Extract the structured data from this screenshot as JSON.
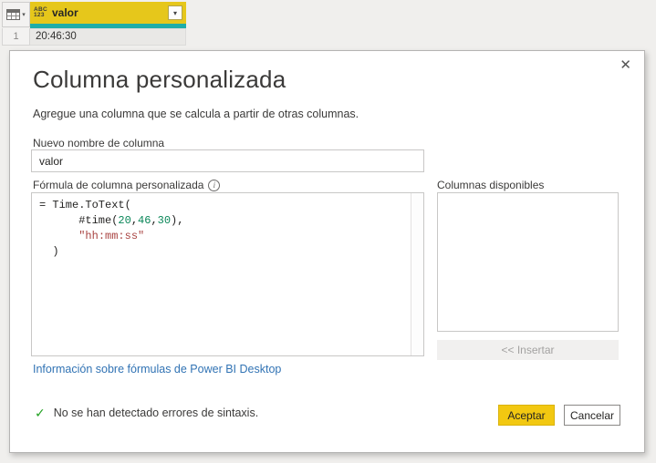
{
  "colors": {
    "page_bg": "#f0efed",
    "header_yellow": "#e6c71b",
    "quality_teal": "#1fada8",
    "accent_yellow": "#f2c811",
    "link_blue": "#3173b4",
    "code_default": "#252423",
    "code_number": "#098658",
    "code_string": "#a94442",
    "success_green": "#21a121"
  },
  "grid": {
    "type_icon_line1": "ABC",
    "type_icon_line2": "123",
    "column_name": "valor",
    "filter_glyph": "▾",
    "row_number": "1",
    "row_value": "20:46:30"
  },
  "dialog": {
    "close_glyph": "✕",
    "title": "Columna personalizada",
    "subtitle": "Agregue una columna que se calcula a partir de otras columnas.",
    "new_column_name_label": "Nuevo nombre de columna",
    "new_column_name_value": "valor",
    "formula_label": "Fórmula de columna personalizada",
    "info_glyph": "i",
    "code_lines": [
      [
        {
          "text": "= Time.ToText(",
          "type": "default"
        }
      ],
      [
        {
          "text": "      #time(",
          "type": "default"
        },
        {
          "text": "20",
          "type": "number"
        },
        {
          "text": ",",
          "type": "default"
        },
        {
          "text": "46",
          "type": "number"
        },
        {
          "text": ",",
          "type": "default"
        },
        {
          "text": "30",
          "type": "number"
        },
        {
          "text": "),",
          "type": "default"
        }
      ],
      [
        {
          "text": "      ",
          "type": "default"
        },
        {
          "text": "\"hh:mm:ss\"",
          "type": "string"
        }
      ],
      [
        {
          "text": "  )",
          "type": "default"
        }
      ]
    ],
    "help_link": "Información sobre fórmulas de Power BI Desktop",
    "available_columns_label": "Columnas disponibles",
    "insert_button_label": "<< Insertar",
    "status_check_glyph": "✓",
    "status_text": "No se han detectado errores de sintaxis.",
    "ok_button_label": "Aceptar",
    "cancel_button_label": "Cancelar"
  }
}
